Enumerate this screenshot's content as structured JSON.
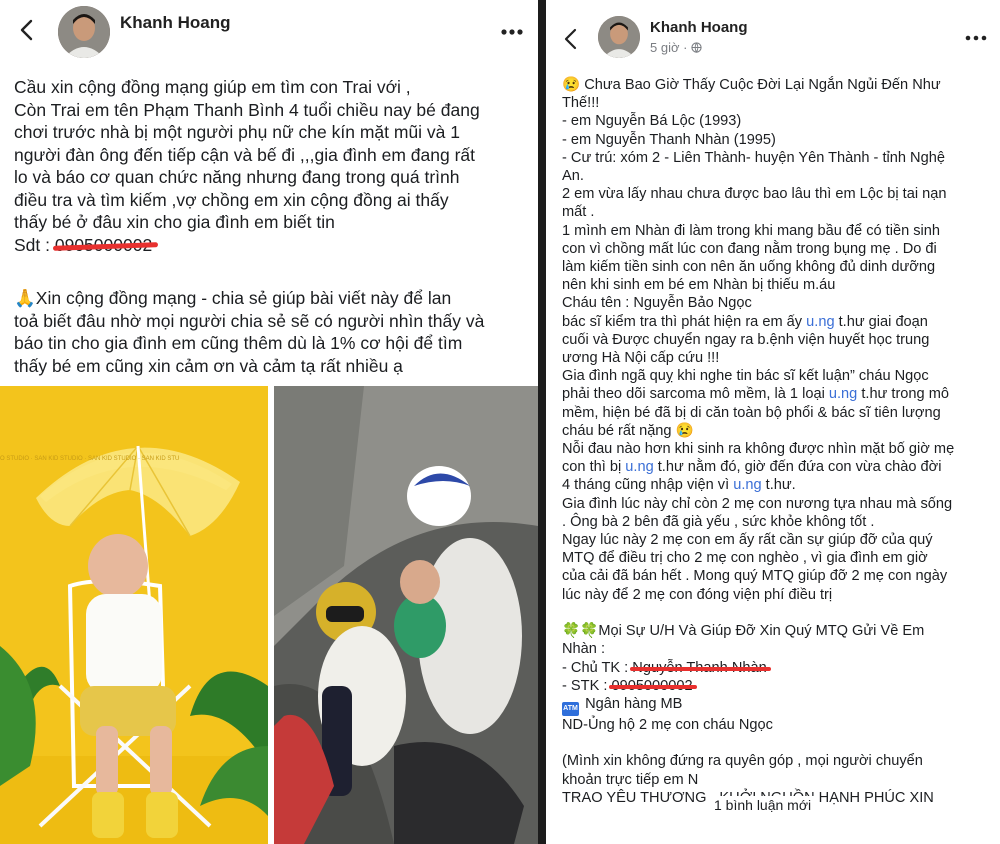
{
  "left_post": {
    "author": "Khanh Hoang",
    "lines": [
      "Cầu xin cộng đồng mạng giúp em tìm con Trai với ,",
      "Còn Trai em tên Phạm Thanh Bình 4 tuổi chiều nay bé đang",
      "chơi trước nhà bị một người phụ nữ che kín mặt mũi và 1",
      "người đàn ông đến tiếp cận và bế đi ,,,gia đình em đang rất",
      "lo và báo cơ quan chức năng nhưng đang trong quá trình",
      "điều tra và tìm kiếm ,vợ chồng em xin cộng đồng ai thấy",
      "thấy bé ở đâu xin cho gia đình em biết tin"
    ],
    "phone_label": "Sdt : ",
    "phone_value": "0905000002",
    "para2_lines": [
      "Xin cộng đồng mạng - chia sẻ giúp bài viết này để lan",
      "toả biết đâu nhờ mọi người chia sẻ sẽ có người nhìn thấy và",
      "báo tin cho gia đình em cũng thêm dù là 1% cơ hội để tìm",
      "thấy bé em cũng xin cảm ơn và cảm tạ rất nhiều ạ"
    ],
    "para2_emoji": "🙏",
    "photo_watermark": "O STUDIO · SAN KID STUDIO · SAN KID STUDIO · SAN KID STU"
  },
  "right_post": {
    "author": "Khanh Hoang",
    "time": "5 giờ ·",
    "title_emoji": "😢",
    "title_lines": [
      "Chưa Bao Giờ Thấy Cuộc Đời Lại Ngắn Ngủi Đến Như",
      "Thế!!!"
    ],
    "lines_a": [
      "- em Nguyễn Bá Lộc (1993)",
      "- em Nguyễn Thanh Nhàn (1995)",
      "- Cư trú: xóm 2 - Liên Thành- huyện Yên Thành - tỉnh Nghệ",
      "An.",
      "2 em vừa lấy nhau chưa được bao lâu thì em Lộc bị tai nạn",
      "mất .",
      "1 mình em Nhàn đi làm trong khi mang bầu để có tiền sinh",
      "con vì chồng mất lúc con đang nằm trong bụng mẹ . Do đi",
      "làm kiếm tiền sinh con nên ăn uống không đủ dinh dưỡng",
      "nên khi sinh em bé em Nhàn  bị thiếu m.áu",
      "Cháu tên : Nguyễn Bảo Ngọc"
    ],
    "seg1": {
      "a": "bác sĩ kiểm tra thì phát hiện ra em ấy ",
      "b": "u.ng",
      "c": " t.hư giai đoạn"
    },
    "lines_b": [
      "cuối và Được chuyển ngay ra b.ệnh viện huyết học trung",
      "ương Hà Nội cấp cứu !!!",
      "Gia đình ngã quỵ khi nghe tin bác sĩ  kết luận” cháu Ngọc"
    ],
    "seg2": {
      "a": "phải theo dõi sarcoma mô mềm, là 1 loại ",
      "b": "u.ng",
      "c": " t.hư trong mô"
    },
    "lines_c": [
      "mềm, hiện bé đã bị di căn toàn bộ phổi & bác sĩ tiên lượng"
    ],
    "seg_sick": {
      "a": "cháu bé rất nặng ",
      "emoji": "😢"
    },
    "lines_d": [
      "Nỗi đau nào hơn khi sinh ra không được nhìn mặt bố giờ mẹ"
    ],
    "seg3": {
      "a": "con thì bị ",
      "b": "u.ng",
      "c": " t.hư nằm đó, giờ đến đứa con vừa chào đời"
    },
    "seg4": {
      "a": "4 tháng cũng nhập viện vì ",
      "b": "u.ng",
      "c": " t.hư."
    },
    "lines_e": [
      "Gia đình lúc này chỉ còn 2 mẹ con nương tựa nhau mà sống",
      ". Ông bà 2 bên đã già yếu , sức khỏe không tốt .",
      "Ngay lúc này 2 mẹ con em ấy rất cần sự giúp đỡ của quý",
      "MTQ  để điều trị cho 2 mẹ con nghèo , vì gia đình em giờ",
      "của cải đã bán hết . Mong quý MTQ giúp đỡ 2 mẹ con ngày",
      "lúc này để 2 mẹ con đóng viện phí điều trị"
    ],
    "donate_emoji": "🍀🍀",
    "donate_lines": [
      "Mọi Sự U/H Và Giúp Đỡ Xin Quý MTQ Gửi Về Em",
      "Nhàn    :"
    ],
    "account_label": "- Chủ TK : ",
    "account_value": "Nguyễn Thanh Nhàn",
    "stk_label": "- STK : ",
    "stk_value": "0905000002",
    "atm_icon_text": "ATM",
    "bank": "Ngân hàng MB",
    "note": "ND-Ủng hộ 2 mẹ con cháu Ngọc",
    "tail_lines": [
      "(Mình xin không đứng ra quyên góp , mọi người chuyển",
      "khoản trực tiếp em N",
      "TRAO YÊU THƯƠNG - KHỞI NGUỒN HẠNH PHÚC XIN"
    ],
    "comment_badge": "1 bình luận mới"
  }
}
